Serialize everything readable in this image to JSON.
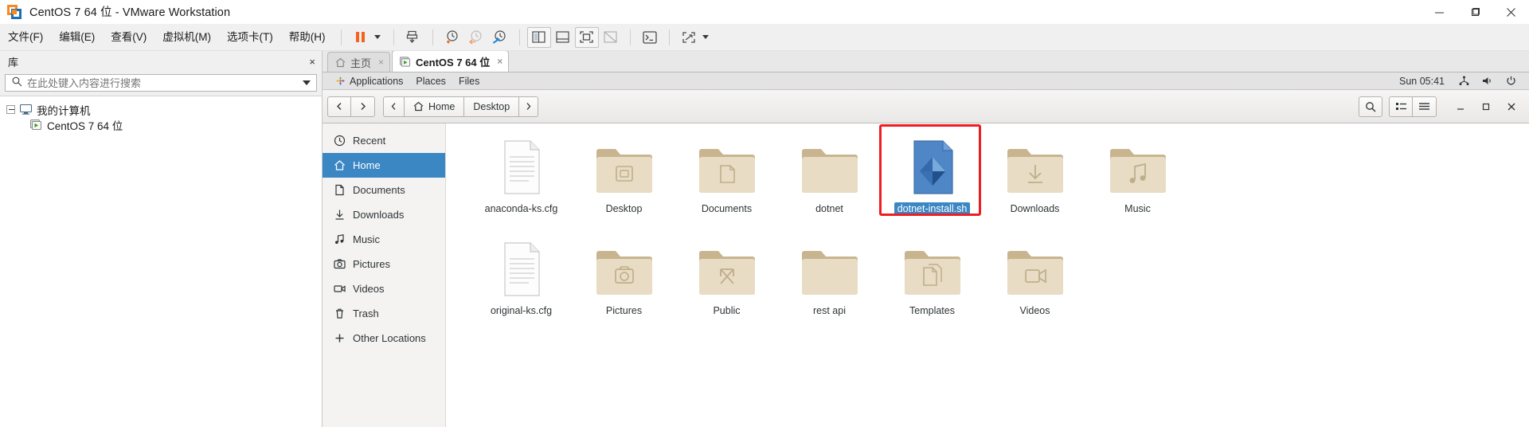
{
  "window": {
    "title": "CentOS 7 64 位 - VMware Workstation",
    "controls": {
      "minimize": "minimize-icon",
      "maximize": "maximize-icon",
      "close": "close-icon"
    },
    "logo": "vmware-logo-icon"
  },
  "menubar": {
    "items": [
      {
        "label": "文件(F)",
        "name": "menu-file"
      },
      {
        "label": "编辑(E)",
        "name": "menu-edit"
      },
      {
        "label": "查看(V)",
        "name": "menu-view"
      },
      {
        "label": "虚拟机(M)",
        "name": "menu-vm"
      },
      {
        "label": "选项卡(T)",
        "name": "menu-tabs"
      },
      {
        "label": "帮助(H)",
        "name": "menu-help"
      }
    ],
    "toolbar": [
      {
        "name": "suspend-button",
        "icon": "pause-icon"
      },
      {
        "name": "power-dropdown",
        "icon": "chevron-down-icon"
      },
      {
        "name": "snapshot-manager-button",
        "icon": "snapshot-icon"
      },
      {
        "name": "take-snapshot-button",
        "icon": "clock-plus-icon"
      },
      {
        "name": "revert-snapshot-button",
        "icon": "clock-back-icon"
      },
      {
        "name": "manage-snapshots-button",
        "icon": "clock-wrench-icon"
      },
      {
        "name": "show-library-button",
        "icon": "sidebar-icon"
      },
      {
        "name": "show-thumbnail-bar-button",
        "icon": "bottom-bar-icon"
      },
      {
        "name": "fullscreen-button",
        "icon": "fullscreen-icon"
      },
      {
        "name": "unity-button",
        "icon": "unity-icon"
      },
      {
        "name": "console-button",
        "icon": "terminal-icon"
      },
      {
        "name": "stretch-button",
        "icon": "stretch-icon"
      },
      {
        "name": "stretch-dropdown",
        "icon": "chevron-down-icon"
      }
    ]
  },
  "library": {
    "header": "库",
    "close": "×",
    "search": {
      "placeholder": "在此处键入内容进行搜索",
      "value": ""
    },
    "tree": [
      {
        "label": "我的计算机",
        "icon": "computer-icon",
        "expanded": true,
        "level": 0
      },
      {
        "label": "CentOS 7 64 位",
        "icon": "vm-running-icon",
        "level": 1
      }
    ]
  },
  "tabs": [
    {
      "label": "主页",
      "icon": "home-icon",
      "active": false,
      "close": "×"
    },
    {
      "label": "CentOS 7 64 位",
      "icon": "vm-running-icon",
      "active": true,
      "close": "×"
    }
  ],
  "gnome": {
    "menus": [
      "Applications",
      "Places",
      "Files"
    ],
    "activities_icon": "gnome-foot-icon",
    "clock": "Sun 05:41",
    "status_icons": [
      "network-icon",
      "volume-icon",
      "power-icon"
    ]
  },
  "nautilus": {
    "nav": {
      "back": "back-arrow-icon",
      "forward": "forward-arrow-icon"
    },
    "breadcrumbs": [
      {
        "label": "",
        "icon": "left-chevron-icon"
      },
      {
        "label": "Home",
        "icon": "home-icon"
      },
      {
        "label": "Desktop",
        "icon": ""
      },
      {
        "label": "",
        "icon": "right-chevron-icon"
      }
    ],
    "header_buttons": [
      "search-icon",
      "grid-view-icon",
      "list-view-icon"
    ],
    "window_controls": {
      "minimize": "−",
      "maximize": "□",
      "close": "✕"
    },
    "places": [
      {
        "label": "Recent",
        "icon": "recent-icon",
        "active": false
      },
      {
        "label": "Home",
        "icon": "home-icon",
        "active": true
      },
      {
        "label": "Documents",
        "icon": "documents-icon",
        "active": false
      },
      {
        "label": "Downloads",
        "icon": "downloads-icon",
        "active": false
      },
      {
        "label": "Music",
        "icon": "music-icon",
        "active": false
      },
      {
        "label": "Pictures",
        "icon": "pictures-icon",
        "active": false
      },
      {
        "label": "Videos",
        "icon": "videos-icon",
        "active": false
      },
      {
        "label": "Trash",
        "icon": "trash-icon",
        "active": false
      },
      {
        "label": "Other Locations",
        "icon": "plus-icon",
        "active": false
      }
    ],
    "files": [
      [
        {
          "name": "anaconda-ks.cfg",
          "type": "text",
          "selected": false,
          "annotated": false
        },
        {
          "name": "Desktop",
          "type": "folder-desktop",
          "selected": false,
          "annotated": false
        },
        {
          "name": "Documents",
          "type": "folder-documents",
          "selected": false,
          "annotated": false
        },
        {
          "name": "dotnet",
          "type": "folder",
          "selected": false,
          "annotated": false
        },
        {
          "name": "dotnet-install.sh",
          "type": "script",
          "selected": true,
          "annotated": true
        },
        {
          "name": "Downloads",
          "type": "folder-downloads",
          "selected": false,
          "annotated": false
        },
        {
          "name": "Music",
          "type": "folder-music",
          "selected": false,
          "annotated": false
        }
      ],
      [
        {
          "name": "original-ks.cfg",
          "type": "text",
          "selected": false,
          "annotated": false
        },
        {
          "name": "Pictures",
          "type": "folder-pictures",
          "selected": false,
          "annotated": false
        },
        {
          "name": "Public",
          "type": "folder-public",
          "selected": false,
          "annotated": false
        },
        {
          "name": "rest api",
          "type": "folder",
          "selected": false,
          "annotated": false
        },
        {
          "name": "Templates",
          "type": "folder-templates",
          "selected": false,
          "annotated": false
        },
        {
          "name": "Videos",
          "type": "folder-videos",
          "selected": false,
          "annotated": false
        }
      ]
    ]
  },
  "colors": {
    "accent": "#3b87c4",
    "annotation": "#ee1d24",
    "vmware_orange": "#f68a20",
    "vmware_blue": "#1a6fb5"
  }
}
